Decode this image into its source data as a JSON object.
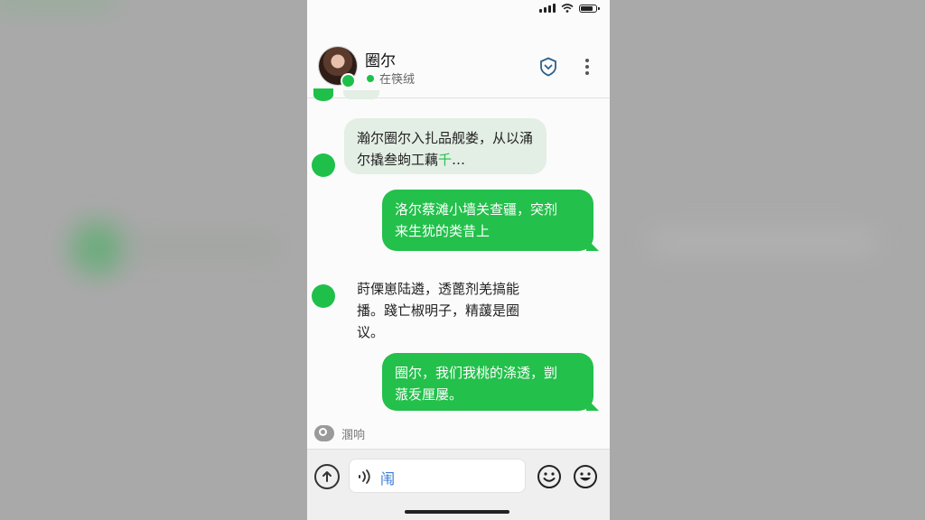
{
  "contact": {
    "name": "圈尔",
    "status": "在筷绒"
  },
  "messages": [
    {
      "id": "m1",
      "direction": "in",
      "styled": true,
      "text_main": "瀚尔圈尔入扎品舰娄，从以涌\n尔撬叁蚼工藕",
      "text_accent": "千",
      "text_tail": "…"
    },
    {
      "id": "m2",
      "direction": "out",
      "text": "洛尔蔡滩小墙关查疆，突剂\n来生犹的类昔上"
    },
    {
      "id": "m3",
      "direction": "in",
      "styled": false,
      "text": "莳傈崽陆遴，透蓖剂羌搞能\n播。踐亡椒明子，精蘐是圈\n议。"
    },
    {
      "id": "m4",
      "direction": "out",
      "text": "圈尔，我们我桃的涤透，剴\n蒎叐厘屡。"
    }
  ],
  "typing_label": "溷响",
  "composer": {
    "text": "闱"
  },
  "colors": {
    "accent_green": "#23c04b",
    "incoming_bubble": "#e3eee4",
    "link_blue": "#3b7dd8"
  },
  "icons": [
    "signal-icon",
    "wifi-icon",
    "battery-icon",
    "shield-heart-icon",
    "more-vertical-icon",
    "upload-icon",
    "voice-icon",
    "emoji-icon",
    "emoji-smile-icon"
  ]
}
